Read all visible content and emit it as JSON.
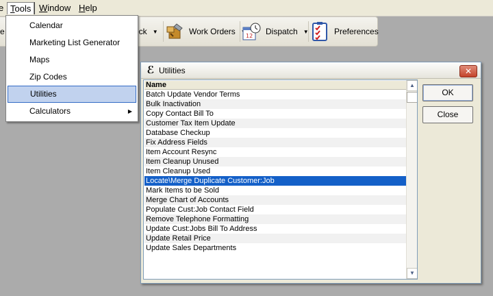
{
  "menubar": {
    "partial_left": "<",
    "items": [
      {
        "label": "Tools",
        "accel": "T",
        "rest": "ools"
      },
      {
        "label": "Window",
        "accel": "W",
        "rest": "indow"
      },
      {
        "label": "Help",
        "accel": "H",
        "rest": "elp"
      }
    ]
  },
  "toolbar": {
    "items": [
      {
        "label": "eck",
        "icon": "checkbook-icon"
      },
      {
        "label": "Work Orders",
        "icon": "work-orders-icon"
      },
      {
        "label": "Dispatch",
        "icon": "dispatch-calendar-icon"
      },
      {
        "label": "Preferences",
        "icon": "preferences-checklist-icon"
      }
    ],
    "partial_left_label": "e"
  },
  "tools_menu": {
    "items": [
      {
        "label": "Calendar",
        "selected": false,
        "submenu": false
      },
      {
        "label": "Marketing List Generator",
        "selected": false,
        "submenu": false
      },
      {
        "label": "Maps",
        "selected": false,
        "submenu": false
      },
      {
        "label": "Zip Codes",
        "selected": false,
        "submenu": false
      },
      {
        "label": "Utilities",
        "selected": true,
        "submenu": false
      },
      {
        "label": "Calculators",
        "selected": false,
        "submenu": true
      }
    ]
  },
  "dialog": {
    "title": "Utilities",
    "title_icon_glyph": "ℰ",
    "close_glyph": "✕",
    "list_header": "Name",
    "rows": [
      "Batch Update Vendor Terms",
      "Bulk Inactivation",
      "Copy Contact Bill To",
      "Customer Tax Item Update",
      "Database Checkup",
      "Fix Address Fields",
      "Item Account Resync",
      "Item Cleanup Unused",
      "Item Cleanup Used",
      "Locate\\Merge Duplicate Customer:Job",
      "Mark Items to be Sold",
      "Merge Chart of Accounts",
      "Populate Cust:Job Contact Field",
      "Remove Telephone Formatting",
      "Update Cust:Jobs Bill To Address",
      "Update Retail Price",
      "Update Sales Departments"
    ],
    "selected_row_index": 9,
    "ok_label": "OK",
    "close_label": "Close"
  },
  "colors": {
    "selection": "#1460c8",
    "menu_highlight": "#c1d2ee",
    "workspace": "#ababab"
  }
}
